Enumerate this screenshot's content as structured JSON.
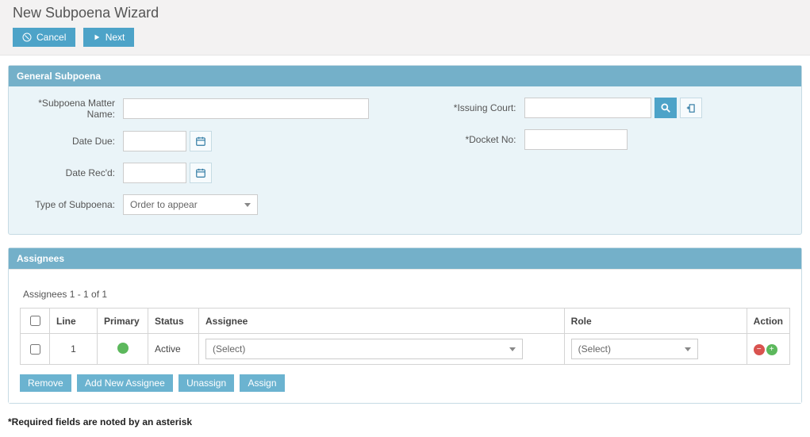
{
  "header": {
    "title": "New Subpoena Wizard",
    "cancel_label": "Cancel",
    "next_label": "Next"
  },
  "general": {
    "panel_title": "General Subpoena",
    "labels": {
      "matter_name": "*Subpoena Matter Name:",
      "date_due": "Date Due:",
      "date_recd": "Date Rec'd:",
      "type": "Type of Subpoena:",
      "issuing_court": "*Issuing Court:",
      "docket_no": "*Docket No:"
    },
    "values": {
      "matter_name": "",
      "date_due": "",
      "date_recd": "",
      "type": "Order to appear",
      "issuing_court": "",
      "docket_no": ""
    }
  },
  "assignees": {
    "panel_title": "Assignees",
    "count_text": "Assignees 1 - 1 of 1",
    "columns": {
      "line": "Line",
      "primary": "Primary",
      "status": "Status",
      "assignee": "Assignee",
      "role": "Role",
      "action": "Action"
    },
    "rows": [
      {
        "line": "1",
        "primary": true,
        "status": "Active",
        "assignee": "(Select)",
        "role": "(Select)"
      }
    ],
    "buttons": {
      "remove": "Remove",
      "add": "Add New Assignee",
      "unassign": "Unassign",
      "assign": "Assign"
    }
  },
  "footnote": "*Required fields are noted by an asterisk"
}
